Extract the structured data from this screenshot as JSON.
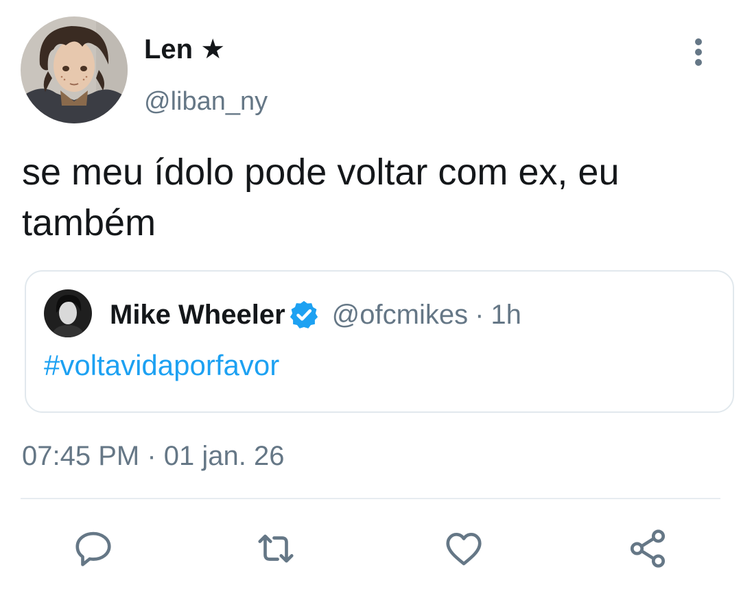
{
  "author": {
    "display_name": "Len ★",
    "handle": "@liban_ny",
    "avatar_icon": "avatar-illustration"
  },
  "tweet": {
    "text": "se meu ídolo pode voltar com ex, eu também",
    "timestamp": "07:45 PM · 01 jan. 26"
  },
  "quoted": {
    "name": "Mike Wheeler",
    "verified_icon": "verified-badge-icon",
    "handle": "@ofcmikes",
    "separator": "·",
    "time": "1h",
    "text": "#voltavidaporfavor"
  },
  "actions": [
    "reply-icon",
    "retweet-icon",
    "like-icon",
    "share-icon"
  ],
  "colors": {
    "text": "#14171a",
    "secondary": "#657786",
    "link": "#1da1f2",
    "border": "#e1e8ed",
    "icon": "#657786"
  }
}
